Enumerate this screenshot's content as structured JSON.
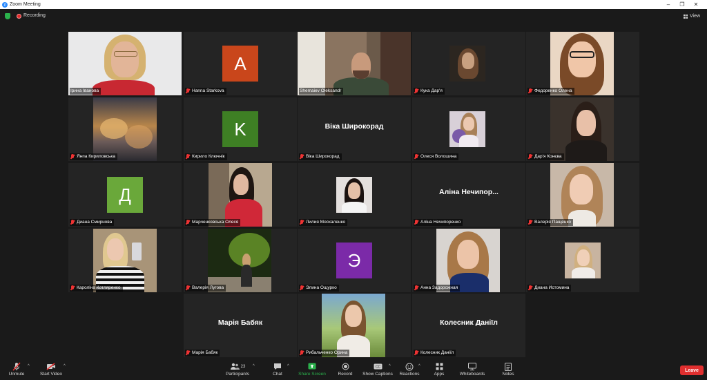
{
  "window": {
    "title": "Zoom Meeting"
  },
  "status": {
    "recording_label": "Recording",
    "view_label": "View"
  },
  "tiles": [
    {
      "name": "Ірина Іванова"
    },
    {
      "name": "Hanna Starkova",
      "initial": "A",
      "color": "#c9461b"
    },
    {
      "name": "Shemaiev Oleksandr"
    },
    {
      "name": "Кука Дар'я"
    },
    {
      "name": "Федоренко Олена"
    },
    {
      "name": "Янпа Кириловська"
    },
    {
      "name": "Кирило Ключнік",
      "initial": "K",
      "color": "#3e7f24"
    },
    {
      "name": "Віка Широкорад",
      "display": "Віка Широкорад"
    },
    {
      "name": "Олеся Волошина"
    },
    {
      "name": "Дар'я Конєва"
    },
    {
      "name": "Диана Смирнова",
      "initial": "Д",
      "color": "#6aa83a"
    },
    {
      "name": "Марченковська Олеся"
    },
    {
      "name": "Лилия Москаленко"
    },
    {
      "name": "Аліна Нечипоренко",
      "display": "Аліна Нечипор..."
    },
    {
      "name": "Валерія Пащенко"
    },
    {
      "name": "Кароліна Котляренко"
    },
    {
      "name": "Валерія Лугова"
    },
    {
      "name": "Элина Ощурко",
      "initial": "Э",
      "color": "#7b2aa8"
    },
    {
      "name": "Анна Задорожная"
    },
    {
      "name": "Диана Истомина"
    },
    {
      "name": "Марія Бабяк",
      "display": "Марія Бабяк"
    },
    {
      "name": "Рибальченко Орина"
    },
    {
      "name": "Колесник Даніїл",
      "display": "Колесник Даніїл"
    }
  ],
  "toolbar": {
    "unmute": "Unmute",
    "start_video": "Start Video",
    "participants": "Participants",
    "participants_count": "23",
    "chat": "Chat",
    "share_screen": "Share Screen",
    "record": "Record",
    "show_captions": "Show Captions",
    "reactions": "Reactions",
    "apps": "Apps",
    "whiteboards": "Whiteboards",
    "notes": "Notes",
    "leave": "Leave"
  },
  "colors": {
    "accent_green": "#2bb24c",
    "speaking_border": "#b8e05a",
    "leave_red": "#e02f2f"
  }
}
